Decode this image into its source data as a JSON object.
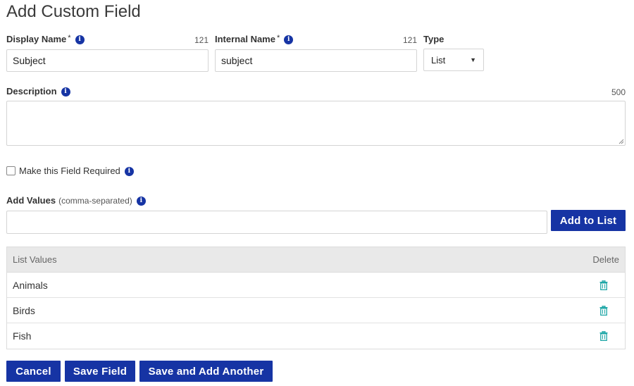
{
  "page": {
    "title": "Add Custom Field"
  },
  "display_name": {
    "label": "Display Name",
    "required_mark": "*",
    "counter": "121",
    "value": "Subject"
  },
  "internal_name": {
    "label": "Internal Name",
    "required_mark": "*",
    "counter": "121",
    "value": "subject"
  },
  "type": {
    "label": "Type",
    "selected": "List"
  },
  "description": {
    "label": "Description",
    "counter": "500",
    "value": ""
  },
  "required_checkbox": {
    "label": "Make this Field Required",
    "checked": false
  },
  "add_values": {
    "label": "Add Values",
    "hint": "(comma-separated)",
    "value": "",
    "button_label": "Add to List"
  },
  "list_table": {
    "header_values": "List Values",
    "header_delete": "Delete",
    "rows": [
      {
        "value": "Animals"
      },
      {
        "value": "Birds"
      },
      {
        "value": "Fish"
      }
    ]
  },
  "footer": {
    "cancel_label": "Cancel",
    "save_label": "Save Field",
    "save_another_label": "Save and Add Another"
  },
  "colors": {
    "primary": "#1634a4",
    "delete_icon": "#1aa5a5",
    "header_bg": "#e9e9e9"
  },
  "icons": {
    "info": "info-icon",
    "delete": "trash-icon",
    "dropdown": "caret-down-icon"
  }
}
